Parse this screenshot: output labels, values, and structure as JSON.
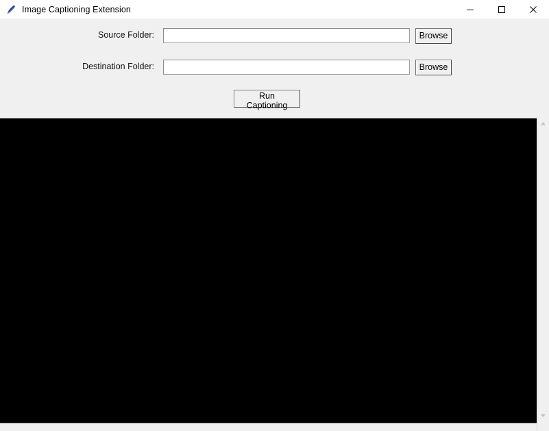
{
  "window": {
    "title": "Image Captioning Extension",
    "icon": "python-feather-icon",
    "background_color": "#f0f0f0",
    "titlebar_color": "#ffffff",
    "controls": {
      "minimize": "minimize-icon",
      "maximize": "maximize-icon",
      "close": "close-icon"
    }
  },
  "form": {
    "source": {
      "label": "Source Folder:",
      "value": "",
      "placeholder": "",
      "browse_label": "Browse"
    },
    "destination": {
      "label": "Destination Folder:",
      "value": "",
      "placeholder": "",
      "browse_label": "Browse"
    },
    "run_button_label": "Run Captioning"
  },
  "output": {
    "text": "",
    "background_color": "#000000",
    "foreground_color": "#ffffff"
  },
  "scrollbar": {
    "up_arrow": "chevron-up-icon",
    "down_arrow": "chevron-down-icon",
    "thumb_color": "#cdcdcd",
    "track_color": "#f0f0f0"
  }
}
